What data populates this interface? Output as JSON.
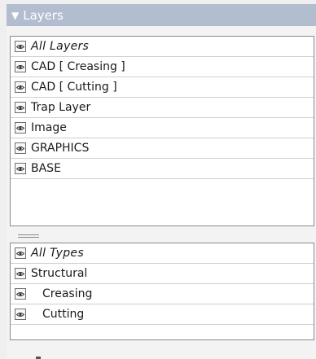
{
  "panel": {
    "title": "Layers",
    "collapse_glyph": "▼",
    "header_color": "#b2bdd0"
  },
  "layers": [
    {
      "label": "All Layers",
      "italic": true,
      "indent": false
    },
    {
      "label": "CAD [ Creasing ]",
      "italic": false,
      "indent": false
    },
    {
      "label": "CAD [ Cutting ]",
      "italic": false,
      "indent": false
    },
    {
      "label": "Trap Layer",
      "italic": false,
      "indent": false
    },
    {
      "label": "Image",
      "italic": false,
      "indent": false
    },
    {
      "label": "GRAPHICS",
      "italic": false,
      "indent": false
    },
    {
      "label": "BASE",
      "italic": false,
      "indent": false
    }
  ],
  "types": [
    {
      "label": "All Types",
      "italic": true,
      "indent": false
    },
    {
      "label": "Structural",
      "italic": false,
      "indent": false
    },
    {
      "label": "Creasing",
      "italic": false,
      "indent": true
    },
    {
      "label": "Cutting",
      "italic": false,
      "indent": true
    }
  ],
  "icons": {
    "visibility": "eye-icon",
    "collapse": "triangle-down-icon",
    "splitter": "splitter-grip-icon"
  }
}
